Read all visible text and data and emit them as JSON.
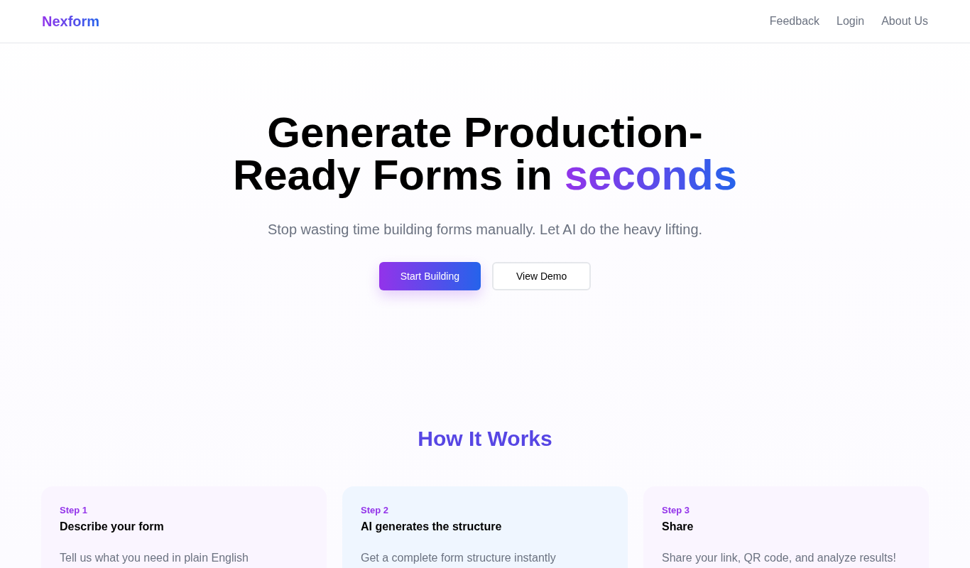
{
  "header": {
    "logo": "Nexform",
    "nav": [
      "Feedback",
      "Login",
      "About Us"
    ]
  },
  "hero": {
    "title": "Generate Production-Ready Forms in",
    "highlight": "seconds",
    "subtitle": "Stop wasting time building forms manually. Let AI do the heavy lifting.",
    "buttons": [
      {
        "label": "Start Building",
        "kind": "primary"
      },
      {
        "label": "View Demo",
        "kind": "secondary"
      }
    ]
  },
  "how_it_works": {
    "heading": "How It Works",
    "steps": [
      {
        "step": "Step 1",
        "title": "Describe your form",
        "description": "Tell us what you need in plain English",
        "color": "#faf5ff"
      },
      {
        "step": "Step 2",
        "title": "AI generates the structure",
        "description": "Get a complete form structure instantly",
        "color": "#eff6ff"
      },
      {
        "step": "Step 3",
        "title": "Share",
        "description": "Share your link, QR code, and analyze results!",
        "color": "#faf5ff"
      }
    ]
  }
}
